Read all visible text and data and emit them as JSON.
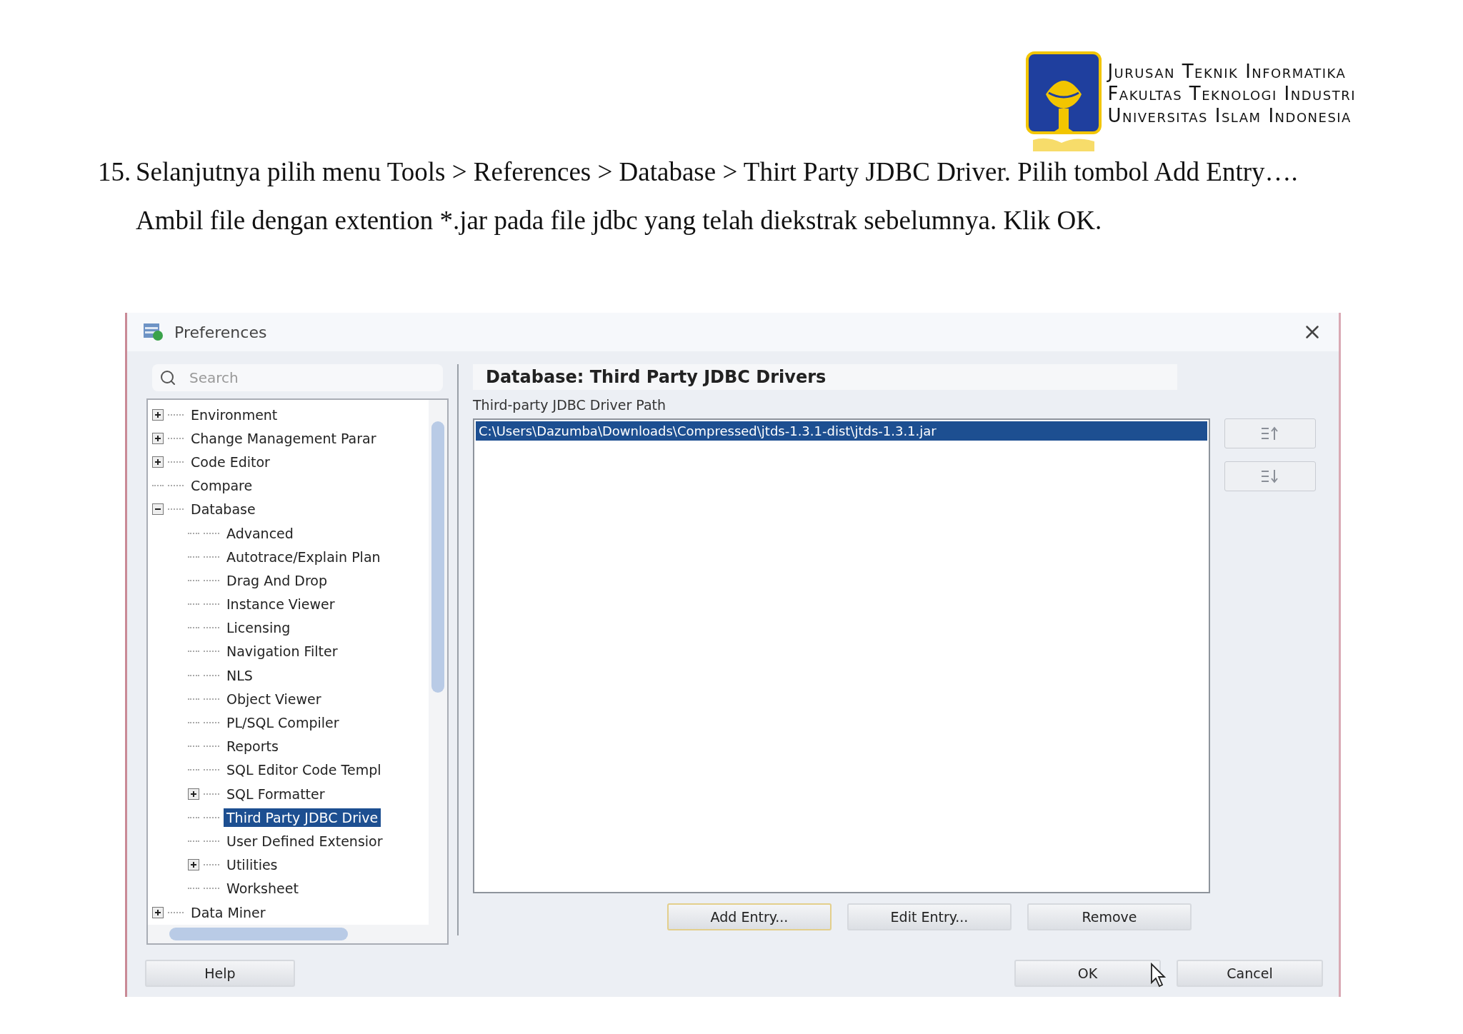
{
  "letterhead": {
    "lines": [
      "Jurusan Teknik Informatika",
      "Fakultas Teknologi Industri",
      "Universitas Islam Indonesia"
    ]
  },
  "instruction": {
    "number": "15.",
    "text": "Selanjutnya pilih menu Tools > References > Database > Thirt Party JDBC Driver. Pilih tombol Add Entry…. Ambil file dengan extention *.jar pada file jdbc yang telah diekstrak sebelumnya. Klik OK."
  },
  "dialog": {
    "title": "Preferences",
    "search": {
      "placeholder": "Search"
    },
    "tree": [
      {
        "label": "Environment",
        "expanded": false,
        "selected": false
      },
      {
        "label": "Change Management Parar",
        "expanded": false,
        "selected": false
      },
      {
        "label": "Code Editor",
        "expanded": false,
        "selected": false
      },
      {
        "label": "Compare",
        "selected": false
      },
      {
        "label": "Database",
        "expanded": true,
        "selected": false,
        "children": [
          {
            "label": "Advanced",
            "selected": false
          },
          {
            "label": "Autotrace/Explain Plan",
            "selected": false
          },
          {
            "label": "Drag And Drop",
            "selected": false
          },
          {
            "label": "Instance Viewer",
            "selected": false
          },
          {
            "label": "Licensing",
            "selected": false
          },
          {
            "label": "Navigation Filter",
            "selected": false
          },
          {
            "label": "NLS",
            "selected": false
          },
          {
            "label": "Object Viewer",
            "selected": false
          },
          {
            "label": "PL/SQL Compiler",
            "selected": false
          },
          {
            "label": "Reports",
            "selected": false
          },
          {
            "label": "SQL Editor Code Templ",
            "selected": false
          },
          {
            "label": "SQL Formatter",
            "expanded": false,
            "selected": false
          },
          {
            "label": "Third Party JDBC Drive",
            "selected": true
          },
          {
            "label": "User Defined Extensior",
            "selected": false
          },
          {
            "label": "Utilities",
            "expanded": false,
            "selected": false
          },
          {
            "label": "Worksheet",
            "selected": false
          }
        ]
      },
      {
        "label": "Data Miner",
        "expanded": false,
        "selected": false
      }
    ],
    "page_title": "Database: Third Party JDBC Drivers",
    "list_label": "Third-party JDBC Driver Path",
    "entries": [
      {
        "path": "C:\\Users\\Dazumba\\Downloads\\Compressed\\jtds-1.3.1-dist\\jtds-1.3.1.jar",
        "selected": true
      }
    ],
    "entry_buttons": [
      {
        "label": "Add Entry...",
        "focused": true
      },
      {
        "label": "Edit Entry...",
        "focused": false
      },
      {
        "label": "Remove",
        "focused": false
      }
    ],
    "help_button": "Help",
    "ok_button": "OK",
    "cancel_button": "Cancel"
  }
}
